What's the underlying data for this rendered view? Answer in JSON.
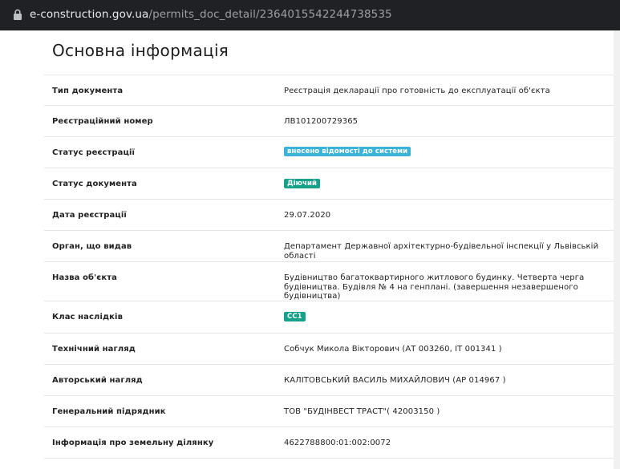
{
  "browser": {
    "url_host": "e-construction.gov.ua",
    "url_path": "/permits_doc_detail/2364015542244738535"
  },
  "page": {
    "title": "Основна інформація"
  },
  "rows": [
    {
      "label": "Тип документа",
      "value": "Реєстрація декларації про готовність до експлуатації об'єкта"
    },
    {
      "label": "Реєстраційний номер",
      "value": "ЛВ101200729365"
    },
    {
      "label": "Статус реєстрації",
      "badge": "внесено відомості до системи",
      "badge_color": "#3bb3d6"
    },
    {
      "label": "Статус документа",
      "badge": "Діючий",
      "badge_color": "#17a08a"
    },
    {
      "label": "Дата реєстрації",
      "value": "29.07.2020"
    },
    {
      "label": "Орган, що видав",
      "value": "Департамент Державної архітектурно-будівельної інспекції у Львівській області"
    },
    {
      "label": "Назва об'єкта",
      "value": "Будівництво багатоквартирного житлового будинку. Четверта черга будівництва. Будівля № 4 на генплані. (завершення незавершеного будівництва)"
    },
    {
      "label": "Клас наслідків",
      "badge": "СС1",
      "badge_color": "#17a08a"
    },
    {
      "label": "Технічний нагляд",
      "value": "Собчук Микола Вікторович (АТ 003260, ІТ 001341 )"
    },
    {
      "label": "Авторський нагляд",
      "value": "КАЛІТОВСЬКИЙ ВАСИЛЬ МИХАЙЛОВИЧ (АР 014967 )"
    },
    {
      "label": "Генеральний підрядник",
      "value": "ТОВ \"БУДІНВЕСТ ТРАСТ\"( 42003150 )"
    },
    {
      "label": "Інформація про земельну ділянку",
      "value": "4622788800:01:002:0072"
    }
  ]
}
